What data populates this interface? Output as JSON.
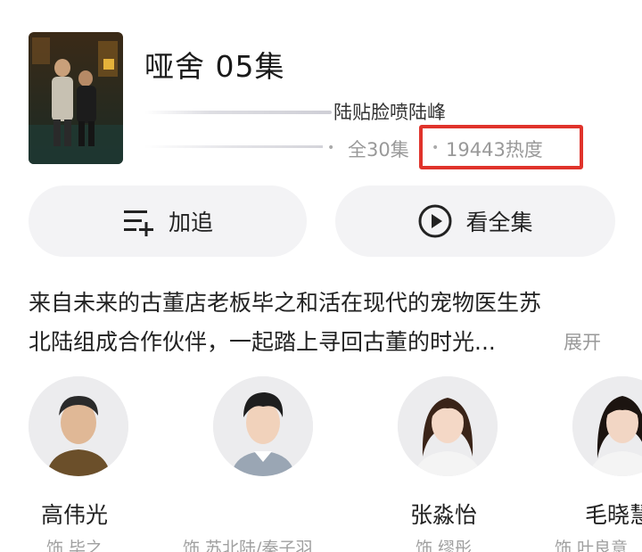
{
  "show": {
    "title": "哑舍 05集",
    "subtitle": "陆贴脸喷陆峰",
    "episodes": "全30集",
    "heat": "19443热度"
  },
  "actions": {
    "follow_label": "加追",
    "watch_label": "看全集"
  },
  "description": {
    "line1": "来自未来的古董店老板毕之和活在现代的宠物医生苏",
    "line2": "北陆组成合作伙伴，一起踏上寻回古董的时光...",
    "expand_label": "展开"
  },
  "cast": [
    {
      "name": "高伟光",
      "role": "饰 毕之"
    },
    {
      "name": "",
      "role": "饰 苏北陆/秦子羽"
    },
    {
      "name": "张淼怡",
      "role": "饰 缪彤"
    },
    {
      "name": "毛晓慧",
      "role": "饰 叶良意"
    }
  ],
  "colors": {
    "highlight_box": "#e0332b",
    "button_bg": "#f3f3f5",
    "muted_text": "#999999"
  }
}
